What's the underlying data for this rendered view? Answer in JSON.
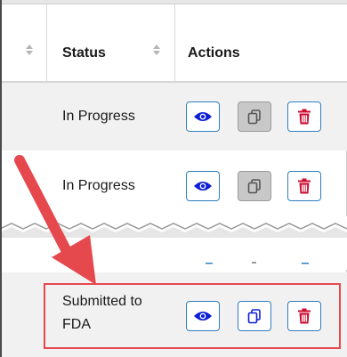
{
  "table": {
    "headers": {
      "status": "Status",
      "actions": "Actions"
    },
    "rows": [
      {
        "status": "In Progress",
        "copy_disabled": true
      },
      {
        "status": "In Progress",
        "copy_disabled": true
      },
      {
        "status": "Submitted to FDA",
        "copy_disabled": false
      }
    ]
  },
  "icons": {
    "view": "eye-icon",
    "copy": "copy-icon",
    "delete": "trash-icon"
  },
  "colors": {
    "accent_blue": "#2f7fc1",
    "eye_blue": "#0d1fd6",
    "trash_red": "#cc0a2f",
    "highlight_red": "#e5484d",
    "row_gray": "#f1f1f1"
  }
}
